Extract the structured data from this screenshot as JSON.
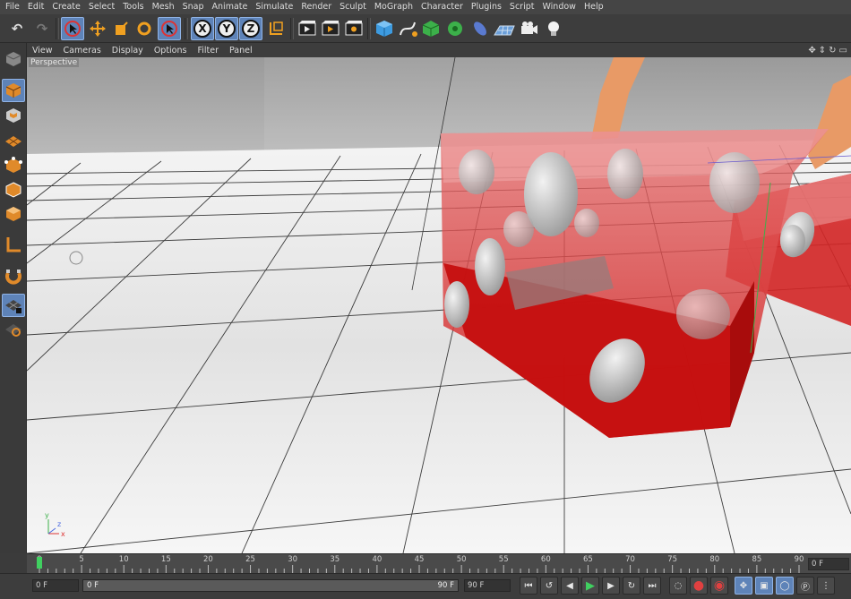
{
  "menu": [
    "File",
    "Edit",
    "Create",
    "Select",
    "Tools",
    "Mesh",
    "Snap",
    "Animate",
    "Simulate",
    "Render",
    "Sculpt",
    "MoGraph",
    "Character",
    "Plugins",
    "Script",
    "Window",
    "Help"
  ],
  "toolbar": {
    "x_label": "X",
    "y_label": "Y",
    "z_label": "Z",
    "icons": [
      "undo-icon",
      "redo-icon",
      "live-selection-icon",
      "move-icon",
      "scale-icon",
      "rotate-icon",
      "last-tool-icon",
      "x-axis-icon",
      "y-axis-icon",
      "z-axis-icon",
      "coordinate-system-icon",
      "render-view-icon",
      "render-picture-viewer-icon",
      "edit-render-settings-icon",
      "cube-icon",
      "spline-pen-icon",
      "subdivision-icon",
      "cloner-icon",
      "deformer-icon",
      "floor-icon",
      "camera-icon",
      "light-icon"
    ]
  },
  "viewport_menu": [
    "View",
    "Cameras",
    "Display",
    "Options",
    "Filter",
    "Panel"
  ],
  "viewport": {
    "label": "Perspective",
    "colors": {
      "dice_red": "#d21a1a",
      "floor": "#f0f0f0",
      "grid_line": "#2a2a2a",
      "pips": "#d8d8d8"
    }
  },
  "timeline": {
    "ticks": [
      "0",
      "5",
      "10",
      "15",
      "20",
      "25",
      "30",
      "35",
      "40",
      "45",
      "50",
      "55",
      "60",
      "65",
      "70",
      "75",
      "80",
      "85",
      "90"
    ],
    "current_frame": "0 F",
    "playhead_frame": 0
  },
  "transport": {
    "start_field": "0 F",
    "range_start": "0 F",
    "range_end": "90 F",
    "end_field": "90 F"
  },
  "colors": {
    "accent": "#5e83b8",
    "play": "#40d060",
    "record": "#e04040"
  }
}
